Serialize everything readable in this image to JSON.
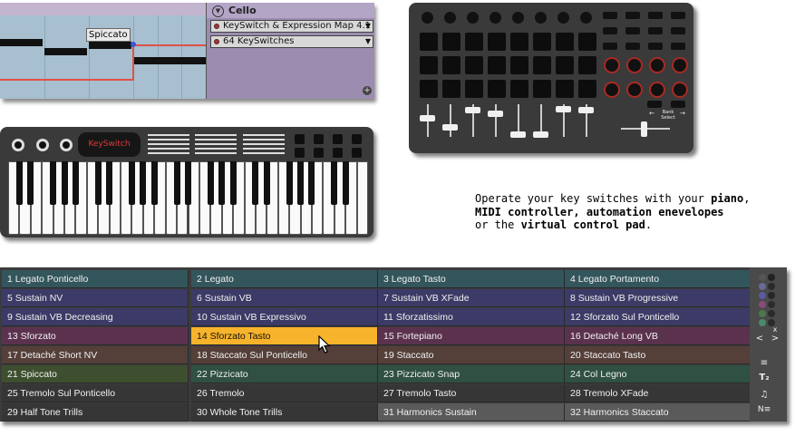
{
  "device": {
    "tooltip": "Spiccato",
    "track_name": "Cello",
    "map_dropdown": "KeySwitch & Expression Map 4.1",
    "keyswitch_dropdown": "64 KeySwitches"
  },
  "keyboard": {
    "display_text": "KeySwitch"
  },
  "control_pad": {
    "bank_label": "Bank",
    "select_label": "Select"
  },
  "caption": {
    "line1_a": "Operate your key switches with your ",
    "line1_b": "piano",
    "line1_c": ",",
    "line2": "MIDI controller, automation enevelopes",
    "line3_a": "or the ",
    "line3_b": "virtual control pad",
    "line3_c": "."
  },
  "keyswitches": [
    {
      "label": "1 Legato Ponticello",
      "color": "#33555c"
    },
    {
      "label": "2 Legato",
      "color": "#33555c"
    },
    {
      "label": "3 Legato Tasto",
      "color": "#33555c"
    },
    {
      "label": "4 Legato Portamento",
      "color": "#33555c"
    },
    {
      "label": "5 Sustain NV",
      "color": "#3c3a66"
    },
    {
      "label": "6 Sustain VB",
      "color": "#3c3a66"
    },
    {
      "label": "7 Sustain VB XFade",
      "color": "#3c3a66"
    },
    {
      "label": "8 Sustain VB Progressive",
      "color": "#3c3a66"
    },
    {
      "label": "9 Sustain VB Decreasing",
      "color": "#3c3a66"
    },
    {
      "label": "10 Sustain VB Expressivo",
      "color": "#3c3a66"
    },
    {
      "label": "11 Sforzatissimo",
      "color": "#3c3a66"
    },
    {
      "label": "12 Sforzato Sul Ponticello",
      "color": "#3c3a66"
    },
    {
      "label": "13 Sforzato",
      "color": "#5b324e"
    },
    {
      "label": "14 Sforzato Tasto",
      "color": "#f7b32b",
      "active": true
    },
    {
      "label": "15 Fortepiano",
      "color": "#5b324e"
    },
    {
      "label": "16 Detaché Long VB",
      "color": "#5b324e"
    },
    {
      "label": "17 Detaché Short NV",
      "color": "#543f39"
    },
    {
      "label": "18 Staccato Sul Ponticello",
      "color": "#543f39"
    },
    {
      "label": "19 Staccato",
      "color": "#543f39"
    },
    {
      "label": "20 Staccato Tasto",
      "color": "#543f39"
    },
    {
      "label": "21 Spiccato",
      "color": "#3e4f2f"
    },
    {
      "label": "22 Pizzicato",
      "color": "#2f5042"
    },
    {
      "label": "23 Pizzicato Snap",
      "color": "#2f5042"
    },
    {
      "label": "24 Col Legno",
      "color": "#2f5042"
    },
    {
      "label": "25 Tremolo Sul Ponticello",
      "color": "#363636"
    },
    {
      "label": "26 Tremolo",
      "color": "#363636"
    },
    {
      "label": "27 Tremolo Tasto",
      "color": "#363636"
    },
    {
      "label": "28 Tremolo XFade",
      "color": "#363636"
    },
    {
      "label": "29 Half Tone Trills",
      "color": "#363636"
    },
    {
      "label": "30 Whole Tone Trills",
      "color": "#363636"
    },
    {
      "label": "31 Harmonics Sustain",
      "color": "#5a5a5a"
    },
    {
      "label": "32 Harmonics Staccato",
      "color": "#5a5a5a"
    }
  ],
  "sidebar": {
    "palette": [
      "#555555",
      "#222222",
      "#6a6a9a",
      "#2a2a2a",
      "#5a5aa0",
      "#262626",
      "#8a4a7a",
      "#2c2c2c",
      "#4a7a4a",
      "#2a2a2a",
      "#4a8a6a",
      "#2a2a2a"
    ],
    "nav_prev": "<",
    "nav_next": ">",
    "close": "x",
    "list_icon": "list-icon",
    "text_icon": "text-size-icon",
    "note_icon": "note-icon",
    "note_list_icon": "note-list-icon"
  }
}
